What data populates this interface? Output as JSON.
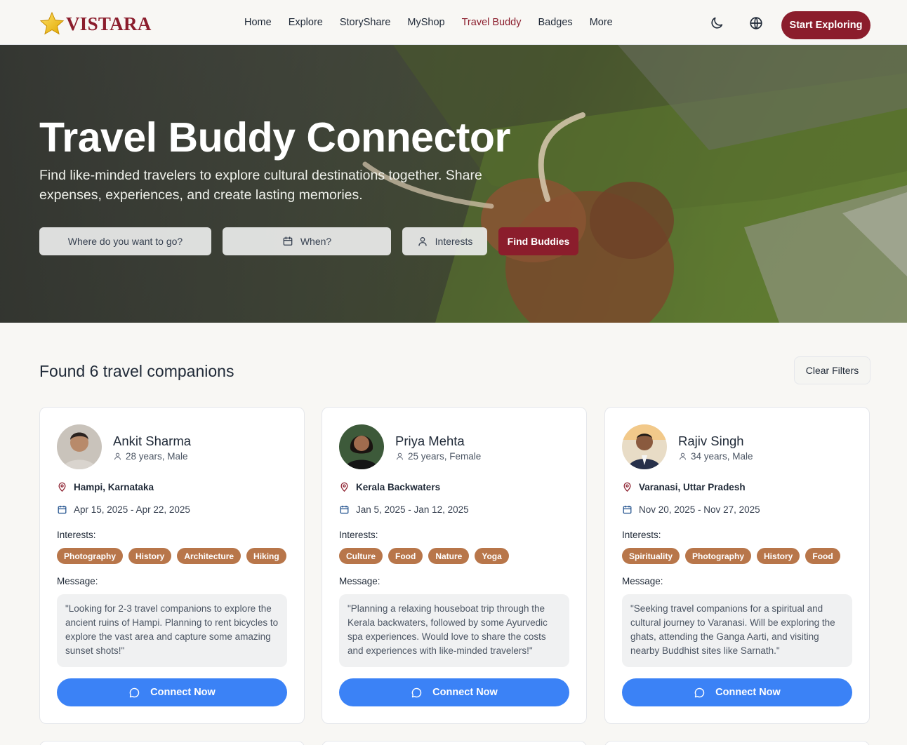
{
  "nav": {
    "brand": "VISTARA",
    "links": [
      "Home",
      "Explore",
      "StoryShare",
      "MyShop",
      "Travel Buddy",
      "Badges",
      "More"
    ],
    "active": "Travel Buddy",
    "theme_icon": "moon-icon",
    "language_icon": "globe-icon",
    "cta": "Start Exploring"
  },
  "hero": {
    "title": "Travel Buddy Connector",
    "subtitle": "Find like-minded travelers to explore cultural destinations together. Share expenses, experiences, and create lasting memories.",
    "destination_placeholder": "Where do you want to go?",
    "when_label": "When?",
    "interests_label": "Interests",
    "find_label": "Find Buddies"
  },
  "results": {
    "title": "Found 6 travel companions",
    "clear_label": "Clear Filters"
  },
  "labels": {
    "interests": "Interests:",
    "message": "Message:",
    "connect": "Connect Now"
  },
  "colors": {
    "brand": "#8b1d2c",
    "tag": "#b8764a",
    "connect": "#3b82f6"
  },
  "companions": [
    {
      "name": "Ankit Sharma",
      "meta": "28 years, Male",
      "location": "Hampi, Karnataka",
      "dates": "Apr 15, 2025 - Apr 22, 2025",
      "interests": [
        "Photography",
        "History",
        "Architecture",
        "Hiking"
      ],
      "message": "\"Looking for 2-3 travel companions to explore the ancient ruins of Hampi. Planning to rent bicycles to explore the vast area and capture some amazing sunset shots!\""
    },
    {
      "name": "Priya Mehta",
      "meta": "25 years, Female",
      "location": "Kerala Backwaters",
      "dates": "Jan 5, 2025 - Jan 12, 2025",
      "interests": [
        "Culture",
        "Food",
        "Nature",
        "Yoga"
      ],
      "message": "\"Planning a relaxing houseboat trip through the Kerala backwaters, followed by some Ayurvedic spa experiences. Would love to share the costs and experiences with like-minded travelers!\""
    },
    {
      "name": "Rajiv Singh",
      "meta": "34 years, Male",
      "location": "Varanasi, Uttar Pradesh",
      "dates": "Nov 20, 2025 - Nov 27, 2025",
      "interests": [
        "Spirituality",
        "Photography",
        "History",
        "Food"
      ],
      "message": "\"Seeking travel companions for a spiritual and cultural journey to Varanasi. Will be exploring the ghats, attending the Ganga Aarti, and visiting nearby Buddhist sites like Sarnath.\""
    }
  ]
}
